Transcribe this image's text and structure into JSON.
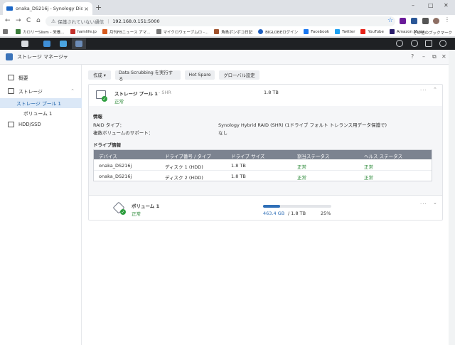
{
  "browser": {
    "tab_title": "onaka_DS216j - Synology DiskSt",
    "tab_close": "×",
    "new_tab": "+",
    "window_controls": [
      "–",
      "□",
      "✕"
    ],
    "nav_icons": [
      "←",
      "→",
      "C",
      "⌂"
    ],
    "security_warning": "保護されていない通信",
    "url": "192.168.0.151:5000",
    "star": "☆",
    "bookmarks": [
      {
        "label": "カロリーSlism - 栄養...",
        "color": "#3b7d3b"
      },
      {
        "label": "hamlife.jp",
        "color": "#c4302b"
      },
      {
        "label": "月刊FBニュース アマ...",
        "color": "#d75b1f"
      },
      {
        "label": "マイクロウェーブムロ -...",
        "color": "#777777"
      },
      {
        "label": "角島ポンポコ日記",
        "color": "#a0522d"
      },
      {
        "label": "BIGLOBEログイン",
        "color": "#1f5fbf"
      },
      {
        "label": "Facebook",
        "color": "#1877f2"
      },
      {
        "label": "Twitter",
        "color": "#1da1f2"
      },
      {
        "label": "YouTube",
        "color": "#e62117"
      },
      {
        "label": "Amazon Music",
        "color": "#2a1d6b"
      }
    ],
    "other_bookmarks": "その他のブックマーク"
  },
  "dsm_taskbar": {
    "items": [
      {
        "name": "main-menu",
        "color": "#d9dce0"
      },
      {
        "name": "file-station",
        "color": "#3f8fd8"
      },
      {
        "name": "control-panel",
        "color": "#4aa3df"
      },
      {
        "name": "storage-manager",
        "color": "#6c8cb8"
      }
    ]
  },
  "app": {
    "title": "ストレージ マネージャ",
    "controls": [
      "?",
      "–",
      "⧉",
      "✕"
    ]
  },
  "sidebar": {
    "items": [
      {
        "label": "概要"
      },
      {
        "label": "ストレージ",
        "chevron": "⌃"
      },
      {
        "label": "ストレージ プール 1"
      },
      {
        "label": "ボリューム 1"
      },
      {
        "label": "HDD/SSD"
      }
    ]
  },
  "toolbar": {
    "create_label": "作成 ▾",
    "scrub_label": "Data Scrubbing を実行する",
    "hotspare_label": "Hot Spare",
    "global_label": "グローバル設定"
  },
  "pool": {
    "name": "ストレージ プール 1",
    "type_suffix": "- SHR",
    "status": "正常",
    "capacity": "1.8 TB",
    "more": "···",
    "expand": "⌄",
    "info_heading": "情報",
    "raid_label": "RAID タイプ：",
    "raid_value": "Synology Hybrid RAID (SHR) (1ドライブ フォルト トレランス用データ保護で)",
    "multi_label": "複数ボリュームのサポート：",
    "multi_value": "なし",
    "drive_heading": "ドライブ情報",
    "columns": [
      "デバイス",
      "ドライブ番号 / タイプ",
      "ドライブ サイズ",
      "割当ステータス",
      "ヘルス ステータス"
    ],
    "drives": [
      {
        "device": "onaka_DS216j",
        "number": "ディスク 1 (HDD)",
        "size": "1.8 TB",
        "alloc": "正常",
        "health": "正常"
      },
      {
        "device": "onaka_DS216j",
        "number": "ディスク 2 (HDD)",
        "size": "1.8 TB",
        "alloc": "正常",
        "health": "正常"
      }
    ]
  },
  "volume": {
    "name": "ボリューム 1",
    "status": "正常",
    "used": "463.4 GB",
    "total": "/ 1.8 TB",
    "percent": "25%",
    "usage_fraction": 0.25,
    "more": "···",
    "expand": "⌄"
  },
  "colors": {
    "accent": "#2f6fb7",
    "ok": "#2e8b3a",
    "table_header": "#7c8390"
  }
}
